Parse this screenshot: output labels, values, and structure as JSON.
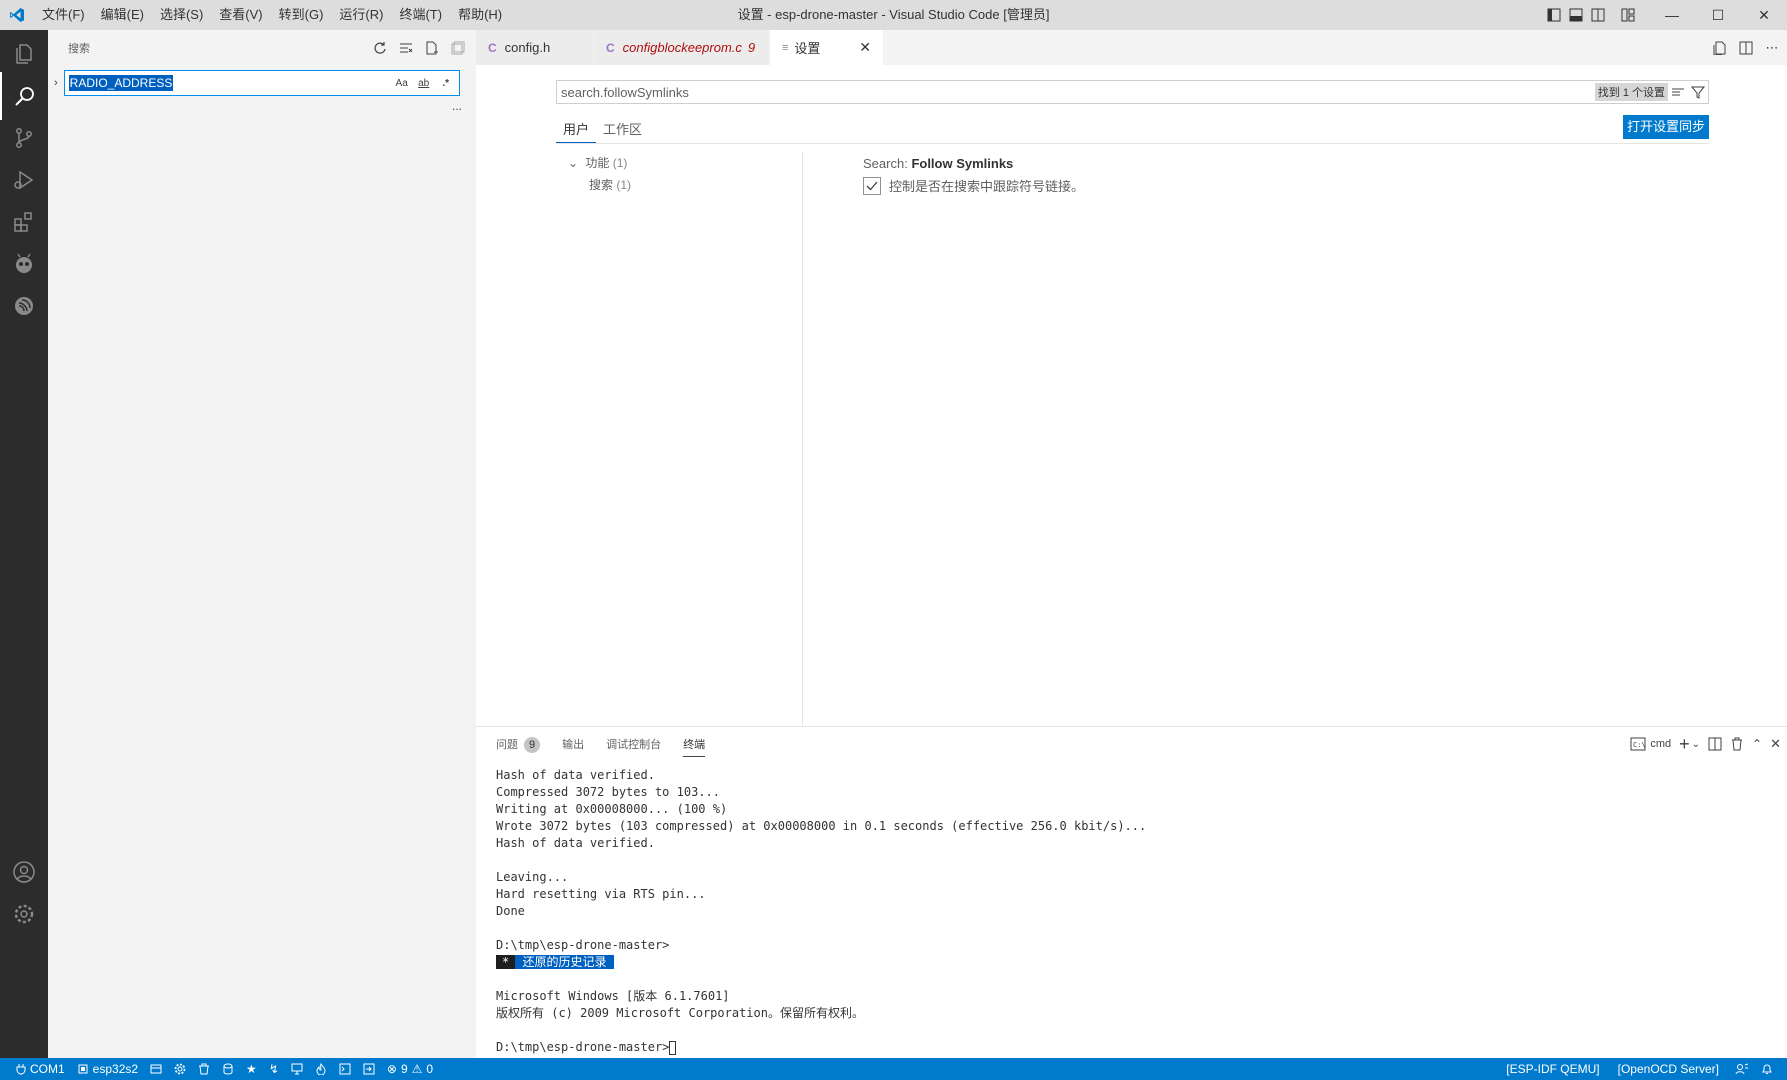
{
  "window": {
    "title": "设置 - esp-drone-master - Visual Studio Code [管理员]",
    "menu": [
      "文件(F)",
      "编辑(E)",
      "选择(S)",
      "查看(V)",
      "转到(G)",
      "运行(R)",
      "终端(T)",
      "帮助(H)"
    ]
  },
  "sidebar": {
    "title": "搜索",
    "search_value": "RADIO_ADDRESS",
    "match_case": "Aa",
    "whole_word": "ab",
    "regex": ".*",
    "more": "..."
  },
  "tabs": [
    {
      "icon": "C",
      "label": "config.h"
    },
    {
      "icon": "C",
      "label": "configblockeeprom.c",
      "problems": "9"
    },
    {
      "icon": "≡",
      "label": "设置"
    }
  ],
  "settings": {
    "search_value": "search.followSymlinks",
    "result_count": "找到 1 个设置",
    "scope_user": "用户",
    "scope_workspace": "工作区",
    "sync_button": "打开设置同步",
    "toc_group": "功能",
    "toc_group_count": "(1)",
    "toc_item": "搜索",
    "toc_item_count": "(1)",
    "item_category": "Search:",
    "item_name": "Follow Symlinks",
    "item_description": "控制是否在搜索中跟踪符号链接。",
    "item_checked": true
  },
  "panel": {
    "tabs": [
      "问题",
      "输出",
      "调试控制台",
      "终端"
    ],
    "problems_count": "9",
    "terminal_name": "cmd",
    "terminal_lines": [
      "Hash of data verified.",
      "Compressed 3072 bytes to 103...",
      "Writing at 0x00008000... (100 %)",
      "Wrote 3072 bytes (103 compressed) at 0x00008000 in 0.1 seconds (effective 256.0 kbit/s)...",
      "Hash of data verified.",
      "",
      "Leaving...",
      "Hard resetting via RTS pin...",
      "Done",
      "",
      "D:\\tmp\\esp-drone-master>"
    ],
    "restored_star": "*",
    "restored_label": "还原的历史记录",
    "terminal_lines_after": [
      "",
      "Microsoft Windows [版本 6.1.7601]",
      "版权所有 (c) 2009 Microsoft Corporation。保留所有权利。",
      ""
    ],
    "prompt": "D:\\tmp\\esp-drone-master>"
  },
  "statusbar": {
    "port": "COM1",
    "target": "esp32s2",
    "errors": "9",
    "warnings": "0",
    "qemu": "[ESP-IDF QEMU]",
    "openocd": "[OpenOCD Server]"
  },
  "colors": {
    "accent": "#007acc",
    "activity_bar": "#2c2c2c",
    "selection": "#0060c0"
  }
}
